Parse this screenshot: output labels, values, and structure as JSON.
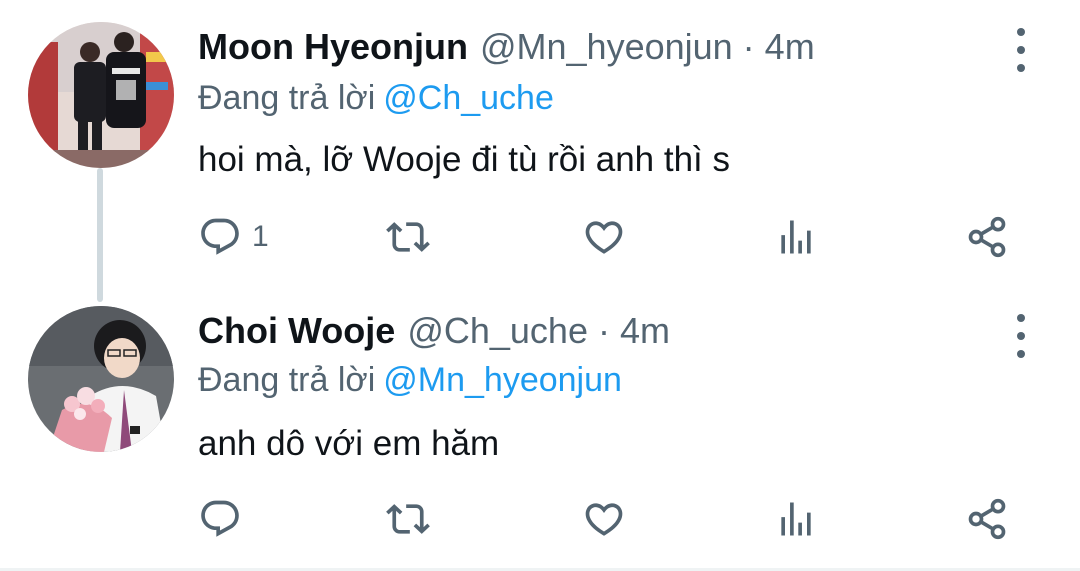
{
  "tweets": [
    {
      "name": "Moon Hyeonjun",
      "handle": "@Mn_hyeonjun",
      "separator": "·",
      "time": "4m",
      "reply_prefix": "Đang trả lời",
      "reply_to": "@Ch_uche",
      "text": "hoi mà, lỡ Wooje đi tù rồi anh thì s",
      "reply_count": "1",
      "avatar_icon": "avatar-photo-jersey"
    },
    {
      "name": "Choi Wooje",
      "handle": "@Ch_uche",
      "separator": "·",
      "time": "4m",
      "reply_prefix": "Đang trả lời",
      "reply_to": "@Mn_hyeonjun",
      "text": "anh dô với em hăm",
      "reply_count": "",
      "avatar_icon": "avatar-photo-bouquet"
    }
  ],
  "icons": {
    "reply": "reply-icon",
    "retweet": "retweet-icon",
    "like": "heart-icon",
    "stats": "stats-icon",
    "share": "share-icon",
    "more": "more-vertical-icon"
  },
  "colors": {
    "link": "#1d9bf0",
    "secondary_text": "#536471",
    "primary_text": "#0f1419",
    "thread_line": "#cfd9de"
  }
}
